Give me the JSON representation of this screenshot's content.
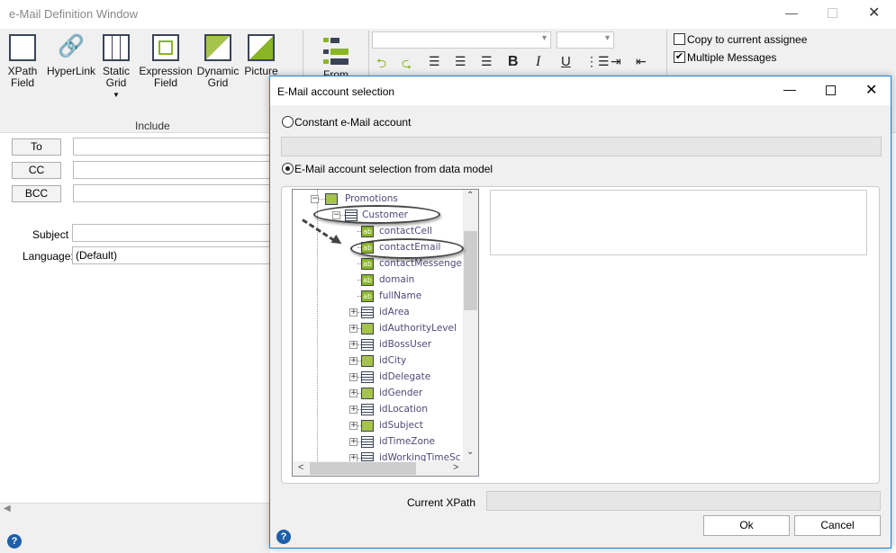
{
  "window": {
    "title": "e-Mail Definition Window"
  },
  "ribbon": {
    "include_items": [
      {
        "label": "XPath\nField",
        "l1": "XPath",
        "l2": "Field"
      },
      {
        "l1": "HyperLink",
        "l2": ""
      },
      {
        "l1": "Static",
        "l2": "Grid"
      },
      {
        "l1": "Expression",
        "l2": "Field"
      },
      {
        "l1": "Dynamic",
        "l2": "Grid"
      },
      {
        "l1": "Picture",
        "l2": ""
      }
    ],
    "include_group": "Include",
    "from_label": "From",
    "font_name": "",
    "font_size": "",
    "copy_to_assignee": {
      "label": "Copy to current assignee",
      "checked": false
    },
    "multiple_messages": {
      "label": "Multiple Messages",
      "checked": true
    }
  },
  "fields": {
    "to": "To",
    "cc": "CC",
    "bcc": "BCC",
    "subject_label": "Subject",
    "language_label": "Language:",
    "language_value": "(Default)"
  },
  "dialog": {
    "title": "E-Mail account selection",
    "constant_option": "Constant e-Mail account",
    "datamodel_option": "E-Mail account selection from data model",
    "selected_option": "datamodel",
    "tree": [
      {
        "label": "Promotions",
        "level": 0,
        "icon": "folder",
        "expander": "minus"
      },
      {
        "label": "Customer",
        "level": 1,
        "icon": "entity",
        "expander": "minus"
      },
      {
        "label": "contactCell",
        "level": 2,
        "icon": "text"
      },
      {
        "label": "contactEmail",
        "level": 2,
        "icon": "text"
      },
      {
        "label": "contactMessenge",
        "level": 2,
        "icon": "text"
      },
      {
        "label": "domain",
        "level": 2,
        "icon": "text"
      },
      {
        "label": "fullName",
        "level": 2,
        "icon": "text"
      },
      {
        "label": "idArea",
        "level": 2,
        "icon": "entity",
        "expander": "plus"
      },
      {
        "label": "idAuthorityLevel",
        "level": 2,
        "icon": "list",
        "expander": "plus"
      },
      {
        "label": "idBossUser",
        "level": 2,
        "icon": "entity",
        "expander": "plus"
      },
      {
        "label": "idCity",
        "level": 2,
        "icon": "list",
        "expander": "plus"
      },
      {
        "label": "idDelegate",
        "level": 2,
        "icon": "entity",
        "expander": "plus"
      },
      {
        "label": "idGender",
        "level": 2,
        "icon": "list",
        "expander": "plus"
      },
      {
        "label": "idLocation",
        "level": 2,
        "icon": "entity",
        "expander": "plus"
      },
      {
        "label": "idSubject",
        "level": 2,
        "icon": "list",
        "expander": "plus"
      },
      {
        "label": "idTimeZone",
        "level": 2,
        "icon": "entity",
        "expander": "plus"
      },
      {
        "label": "idWorkingTimeSc",
        "level": 2,
        "icon": "entity",
        "expander": "plus"
      }
    ],
    "current_xpath_label": "Current XPath",
    "current_xpath_value": "",
    "ok": "Ok",
    "cancel": "Cancel",
    "help": "?"
  },
  "footer": {
    "help": "?"
  },
  "colors": {
    "accent": "#1883d7",
    "icon_green": "#8ab626",
    "tree_text": "#4d4a7a"
  }
}
